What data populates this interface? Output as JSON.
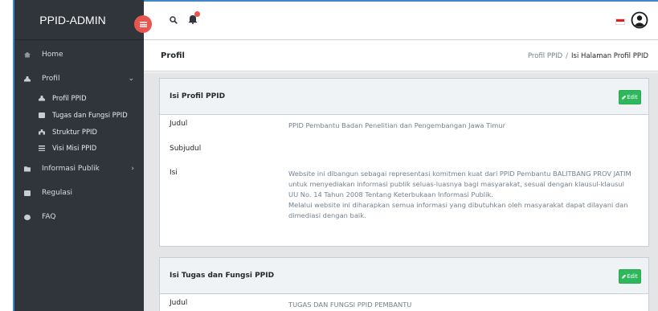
{
  "app": {
    "brand": "PPID-ADMIN"
  },
  "sidebar": {
    "items": [
      {
        "label": "Home",
        "icon": "home-icon"
      },
      {
        "label": "Profil",
        "icon": "user-icon",
        "expanded": true
      },
      {
        "label": "Informasi Publik",
        "icon": "folder-icon"
      },
      {
        "label": "Regulasi",
        "icon": "book-icon"
      },
      {
        "label": "FAQ",
        "icon": "chat-icon"
      }
    ],
    "subitems": [
      {
        "label": "Profil PPID",
        "icon": "user-icon"
      },
      {
        "label": "Tugas dan Fungsi PPID",
        "icon": "card-icon"
      },
      {
        "label": "Struktur PPID",
        "icon": "sitemap-icon"
      },
      {
        "label": "Visi Misi PPID",
        "icon": "list-icon"
      }
    ],
    "caret_open": "⌄",
    "caret_closed": "›"
  },
  "header": {
    "notification_count": "0",
    "language_flag": "flag-id-icon"
  },
  "page": {
    "title": "Profil",
    "breadcrumb": [
      "Profil PPID",
      "Isi Halaman Profil PPID"
    ],
    "breadcrumb_sep": "/"
  },
  "cards": [
    {
      "title": "Isi Profil PPID",
      "edit_label": "Edit",
      "rows": {
        "judul_label": "Judul",
        "judul_value": "PPID Pembantu Badan Penelitian dan Pengembangan Jawa Timur",
        "subjudul_label": "Subjudul",
        "subjudul_value": "",
        "isi_label": "Isi",
        "isi_p1": "Website ini dibangun sebagai representasi komitmen kuat dari PPID Pembantu BALITBANG PROV JATIM untuk menyediakan informasi publik seluas-luasnya bagi masyarakat, sesuai dengan klausul-klausul UU No. 14 Tahun 2008 Tentang Keterbukaan Informasi Publik.",
        "isi_p2": "Melalui website ini diharapkan semua informasi yang dibutuhkan oleh masyarakat dapat dilayani dan dimediasi dengan baik."
      }
    },
    {
      "title": "Isi Tugas dan Fungsi PPID",
      "edit_label": "Edit",
      "rows": {
        "judul_label": "Judul",
        "judul_value": "TUGAS DAN FUNGSI PPID PEMBANTU"
      }
    }
  ],
  "colors": {
    "sidebar_bg": "#2f353a",
    "accent_red": "#e8554e",
    "edit_green": "#2eb85c",
    "card_header_bg": "#f0f3f5",
    "main_bg": "#e4e5e6"
  }
}
